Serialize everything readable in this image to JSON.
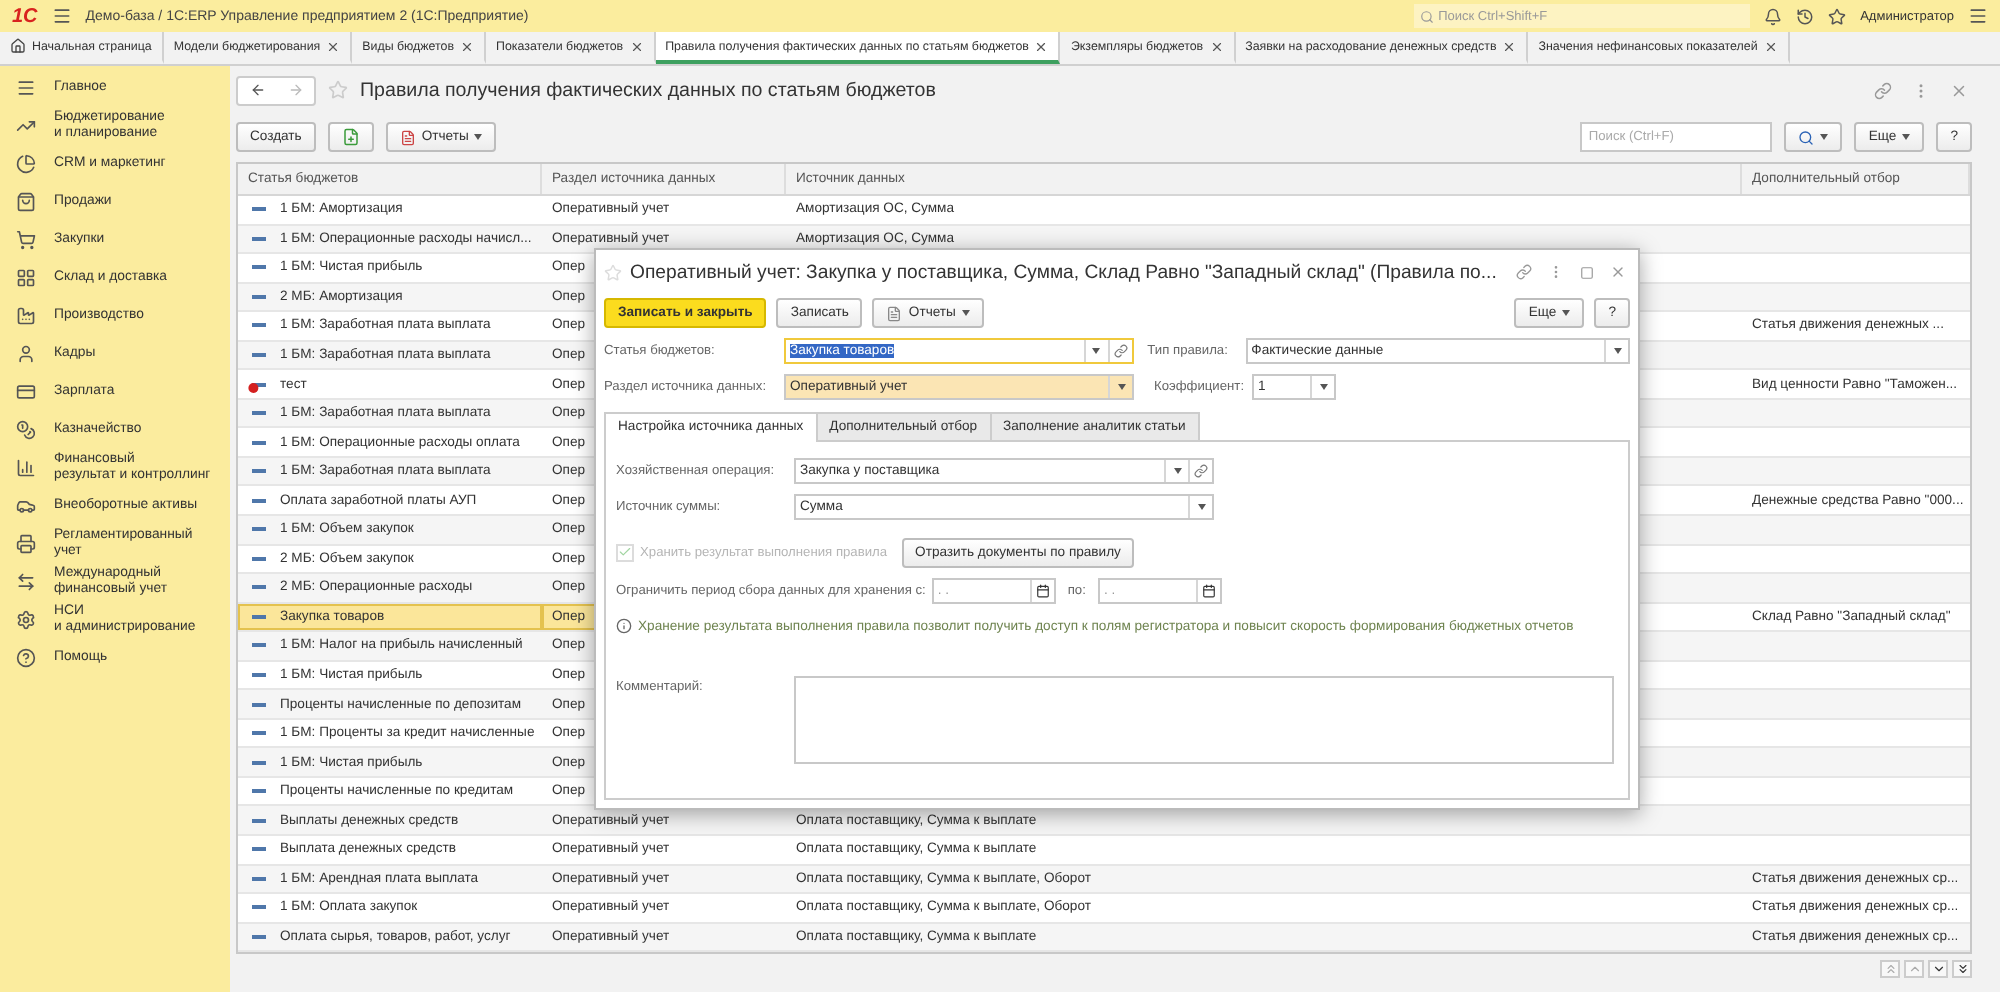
{
  "app_bar": {
    "logo": "1С",
    "title": "Демо-база / 1С:ERP Управление предприятием 2  (1С:Предприятие)",
    "search_placeholder": "Поиск Ctrl+Shift+F",
    "user": "Администратор"
  },
  "tabs": [
    {
      "label": "Начальная страница",
      "kind": "home",
      "selected": false
    },
    {
      "label": "Модели бюджетирования",
      "kind": "doc",
      "selected": false
    },
    {
      "label": "Виды бюджетов",
      "kind": "doc",
      "selected": false
    },
    {
      "label": "Показатели бюджетов",
      "kind": "doc",
      "selected": false
    },
    {
      "label": "Правила получения фактических данных по статьям бюджетов",
      "kind": "doc",
      "selected": true
    },
    {
      "label": "Экземпляры бюджетов",
      "kind": "doc",
      "selected": false
    },
    {
      "label": "Заявки на расходование денежных средств",
      "kind": "doc",
      "selected": false
    },
    {
      "label": "Значения нефинансовых показателей",
      "kind": "doc",
      "selected": false
    }
  ],
  "sidebar": {
    "items": [
      {
        "label": "Главное"
      },
      {
        "label": "Бюджетирование\nи планирование"
      },
      {
        "label": "CRM и маркетинг"
      },
      {
        "label": "Продажи"
      },
      {
        "label": "Закупки"
      },
      {
        "label": "Склад и доставка"
      },
      {
        "label": "Производство"
      },
      {
        "label": "Кадры"
      },
      {
        "label": "Зарплата"
      },
      {
        "label": "Казначейство"
      },
      {
        "label": "Финансовый\nрезультат и контроллинг"
      },
      {
        "label": "Внеоборотные активы"
      },
      {
        "label": "Регламентированный\nучет"
      },
      {
        "label": "Международный\nфинансовый учет"
      },
      {
        "label": "НСИ\nи администрирование"
      },
      {
        "label": "Помощь"
      }
    ]
  },
  "page": {
    "title": "Правила получения фактических данных по статьям бюджетов",
    "create": "Создать",
    "reports": "Отчеты",
    "search_placeholder": "Поиск (Ctrl+F)",
    "more": "Еще",
    "help": "?"
  },
  "table": {
    "columns": [
      "Статья бюджетов",
      "Раздел источника данных",
      "Источник данных",
      "Дополнительный отбор"
    ],
    "rows": [
      {
        "article": "1 БМ: Амортизация",
        "section": "Оперативный учет",
        "source": "Амортизация ОС, Сумма",
        "selected": false,
        "deleted": false
      },
      {
        "article": "1 БМ: Операционные расходы начисл...",
        "section": "Оперативный учет",
        "source": "Амортизация ОС, Сумма",
        "selected": false,
        "deleted": false
      },
      {
        "article": "1 БМ: Чистая прибыль",
        "section": "Опер",
        "selected": false,
        "deleted": false
      },
      {
        "article": "2 МБ: Амортизация",
        "section": "Опер",
        "selected": false,
        "deleted": false
      },
      {
        "article": "1 БМ: Заработная плата выплата",
        "section": "Опер",
        "extra": "Статья движения денежных ...",
        "selected": false,
        "deleted": false
      },
      {
        "article": "1 БМ: Заработная плата выплата",
        "section": "Опер",
        "selected": false,
        "deleted": false
      },
      {
        "article": "тест",
        "section": "Опер",
        "extra": "Вид ценности Равно \"Таможен...",
        "selected": false,
        "deleted": true
      },
      {
        "article": "1 БМ: Заработная плата выплата",
        "section": "Опер",
        "selected": false,
        "deleted": false
      },
      {
        "article": "1 БМ: Операционные расходы оплата",
        "section": "Опер",
        "selected": false,
        "deleted": false
      },
      {
        "article": "1 БМ: Заработная плата выплата",
        "section": "Опер",
        "selected": false,
        "deleted": false
      },
      {
        "article": "Оплата заработной платы АУП",
        "section": "Опер",
        "extra": "Денежные средства Равно \"000...",
        "selected": false,
        "deleted": false
      },
      {
        "article": "1 БМ: Объем закупок",
        "section": "Опер",
        "selected": false,
        "deleted": false
      },
      {
        "article": "2 МБ: Объем закупок",
        "section": "Опер",
        "selected": false,
        "deleted": false
      },
      {
        "article": "2 МБ: Операционные расходы",
        "section": "Опер",
        "selected": false,
        "deleted": false
      },
      {
        "article": "Закупка товаров",
        "section": "Опер",
        "extra": "Склад Равно \"Западный склад\"",
        "selected": true,
        "deleted": false
      },
      {
        "article": "1 БМ: Налог на прибыль начисленный",
        "section": "Опер",
        "selected": false,
        "deleted": false
      },
      {
        "article": "1 БМ: Чистая прибыль",
        "section": "Опер",
        "selected": false,
        "deleted": false
      },
      {
        "article": "Проценты начисленные по депозитам",
        "section": "Опер",
        "selected": false,
        "deleted": false
      },
      {
        "article": "1 БМ: Проценты за кредит начисленные",
        "section": "Опер",
        "selected": false,
        "deleted": false
      },
      {
        "article": "1 БМ: Чистая прибыль",
        "section": "Опер",
        "selected": false,
        "deleted": false
      },
      {
        "article": "Проценты начисленные по кредитам",
        "section": "Опер",
        "selected": false,
        "deleted": false
      },
      {
        "article": "Выплаты денежных средств",
        "section": "Оперативный учет",
        "source": "Оплата поставщику, Сумма к выплате",
        "selected": false,
        "deleted": false
      },
      {
        "article": "Выплата денежных средств",
        "section": "Оперативный учет",
        "source": "Оплата поставщику, Сумма к выплате",
        "selected": false,
        "deleted": false
      },
      {
        "article": "1 БМ: Арендная плата выплата",
        "section": "Оперативный учет",
        "source": "Оплата поставщику, Сумма к выплате, Оборот",
        "extra": "Статья движения денежных ср...",
        "selected": false,
        "deleted": false
      },
      {
        "article": "1 БМ: Оплата закупок",
        "section": "Оперативный учет",
        "source": "Оплата поставщику, Сумма к выплате, Оборот",
        "extra": "Статья движения денежных ср...",
        "selected": false,
        "deleted": false
      },
      {
        "article": "Оплата сырья, товаров, работ, услуг",
        "section": "Оперативный учет",
        "source": "Оплата поставщику, Сумма к выплате",
        "extra": "Статья движения денежных ср...",
        "selected": false,
        "deleted": false
      }
    ]
  },
  "dialog": {
    "title": "Оперативный учет: Закупка у поставщика, Сумма, Склад Равно \"Западный склад\" (Правила по...",
    "save_close": "Записать и закрыть",
    "save": "Записать",
    "reports": "Отчеты",
    "more": "Еще",
    "help": "?",
    "article": {
      "label": "Статья бюджетов:",
      "value": "Закупка товаров"
    },
    "rule_type": {
      "label": "Тип правила:",
      "value": "Фактические данные"
    },
    "section": {
      "label": "Раздел источника данных:",
      "value": "Оперативный учет"
    },
    "coefficient": {
      "label": "Коэффициент:",
      "value": "1"
    },
    "tabs": [
      {
        "label": "Настройка источника данных",
        "selected": true
      },
      {
        "label": "Дополнительный отбор",
        "selected": false
      },
      {
        "label": "Заполнение аналитик статьи",
        "selected": false
      }
    ],
    "operation": {
      "label": "Хозяйственная операция:",
      "value": "Закупка у поставщика"
    },
    "amount_source": {
      "label": "Источник суммы:",
      "value": "Сумма"
    },
    "store_result": {
      "label": "Хранить результат выполнения правила",
      "checked": true,
      "disabled": true
    },
    "post_button": "Отразить документы по правилу",
    "period": {
      "label": "Ограничить период сбора данных для хранения с:",
      "from": ".  .",
      "to_label": "по:",
      "to": ".  ."
    },
    "info": "Хранение результата выполнения правила позволит получить доступ к полям регистратора и повысит скорость формирования бюджетных отчетов",
    "comment": {
      "label": "Комментарий:"
    }
  }
}
